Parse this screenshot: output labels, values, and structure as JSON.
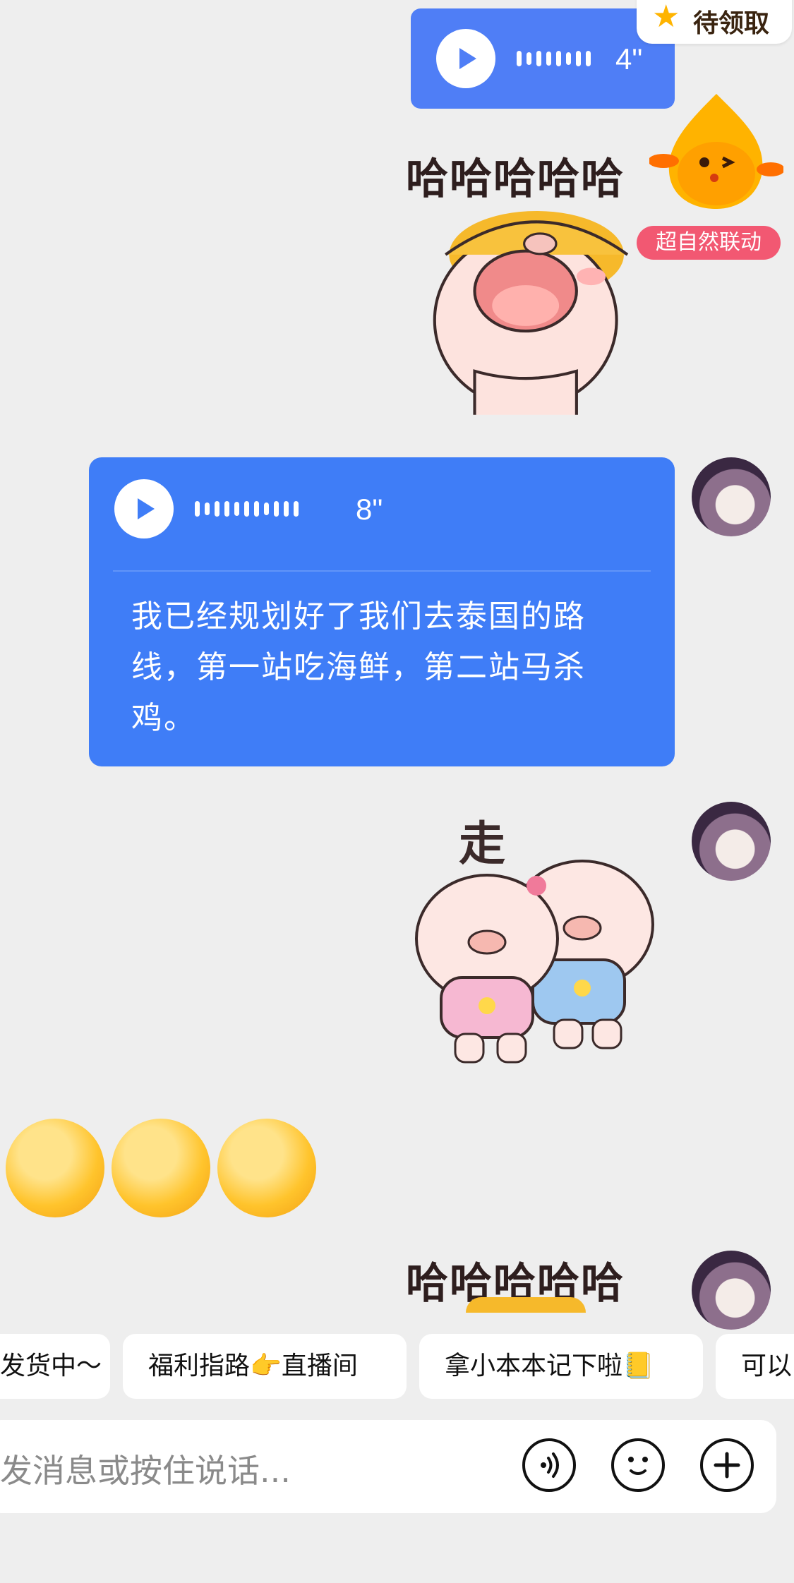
{
  "reward": {
    "label": "待领取",
    "tag": "超自然联动"
  },
  "messages": {
    "voice_small": {
      "duration": "4\""
    },
    "laugh_sticker_text": "哈哈哈哈哈",
    "voice_big": {
      "duration": "8\"",
      "transcript": "我已经规划好了我们去泰国的路线，第一站吃海鲜，第二站马杀鸡。"
    },
    "go_sticker_text": "走",
    "laugh_sticker_text_2": "哈哈哈哈哈"
  },
  "quick_replies": [
    "发货中～",
    "福利指路👉直播间",
    "拿小本本记下啦📒",
    "可以"
  ],
  "input": {
    "placeholder": "发消息或按住说话..."
  },
  "icons": [
    "voice-icon",
    "emoji-icon",
    "plus-icon"
  ]
}
